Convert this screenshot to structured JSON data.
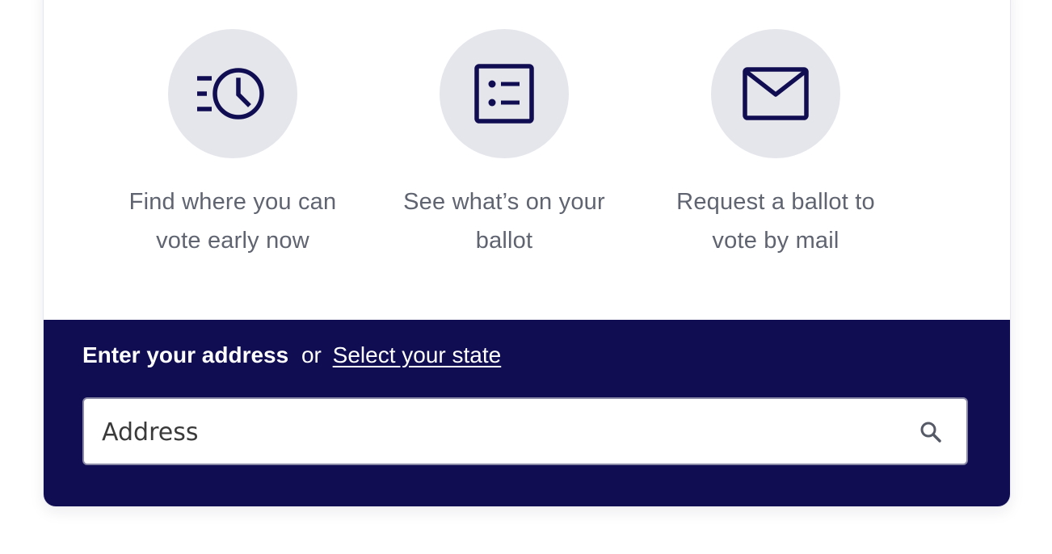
{
  "features": [
    {
      "icon": "early-voting-clock-icon",
      "line1": "Find where you can",
      "line2": "vote early now"
    },
    {
      "icon": "ballot-list-icon",
      "line1": "See what’s on your",
      "line2": "ballot"
    },
    {
      "icon": "mail-envelope-icon",
      "line1": "Request a ballot to",
      "line2": "vote by mail"
    }
  ],
  "address": {
    "prompt_strong": "Enter your address",
    "prompt_or": "or",
    "select_state_link": "Select your state",
    "input_placeholder": "Address",
    "input_value": ""
  },
  "colors": {
    "navy": "#100d52",
    "icon_circle": "#e5e6ec",
    "feature_text": "#5f6470"
  }
}
